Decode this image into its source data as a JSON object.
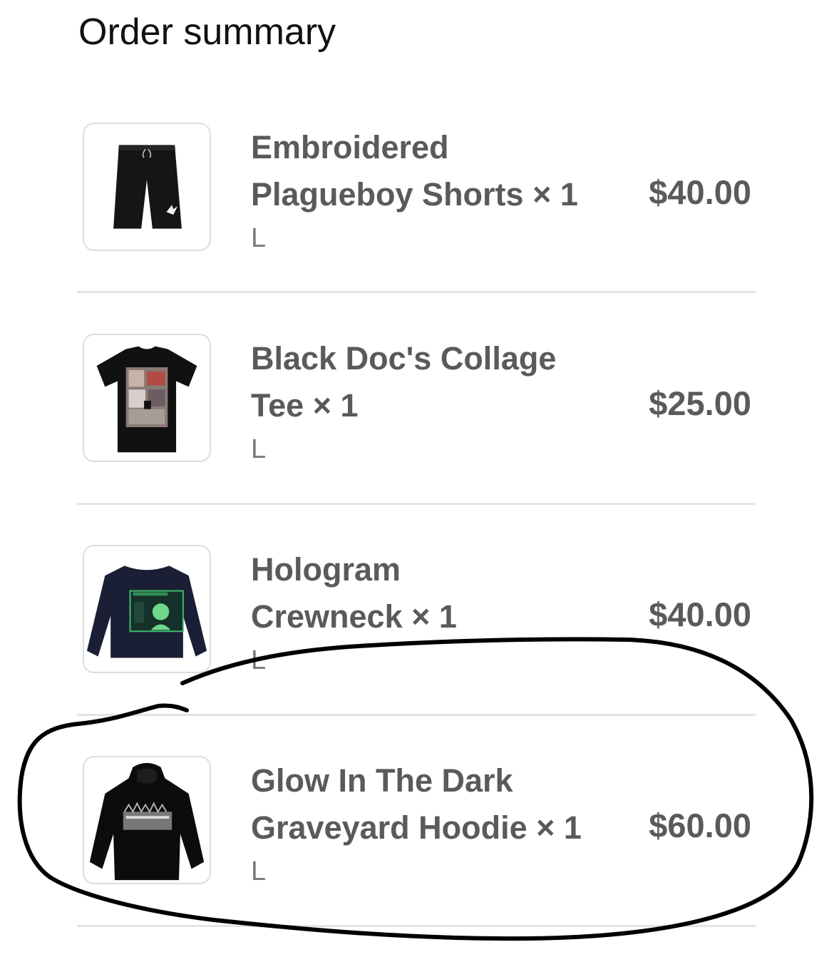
{
  "summary": {
    "title": "Order summary"
  },
  "items": [
    {
      "name_line1": "Embroidered",
      "name_line2": "Plagueboy Shorts × 1",
      "variant": "L",
      "price": "$40.00",
      "image_icon": "shorts-icon"
    },
    {
      "name_line1": "Black Doc's Collage",
      "name_line2": "Tee × 1",
      "variant": "L",
      "price": "$25.00",
      "image_icon": "tshirt-icon"
    },
    {
      "name_line1": "Hologram",
      "name_line2": "Crewneck × 1",
      "variant": "L",
      "price": "$40.00",
      "image_icon": "crewneck-icon"
    },
    {
      "name_line1": "Glow In The Dark",
      "name_line2": "Graveyard Hoodie × 1",
      "variant": "L",
      "price": "$60.00",
      "image_icon": "hoodie-icon"
    }
  ],
  "colors": {
    "text_primary": "#111111",
    "text_secondary": "#5a5a5a",
    "divider": "#e4e4e4",
    "annotation_ink": "#000000"
  }
}
